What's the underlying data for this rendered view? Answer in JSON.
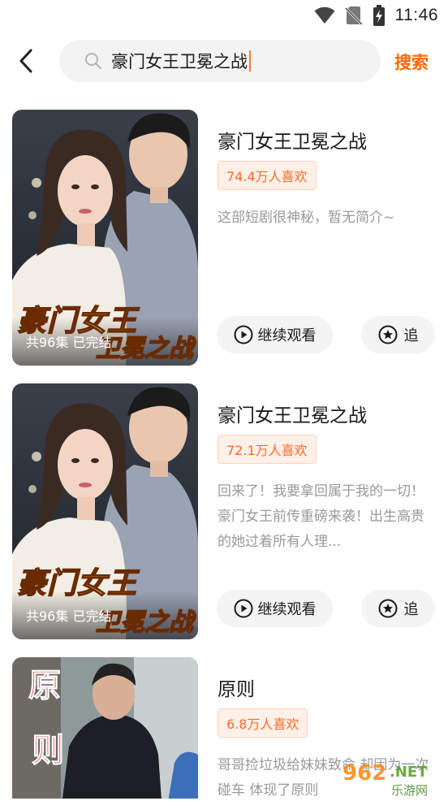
{
  "status": {
    "time": "11:46",
    "icons": [
      "wifi-icon",
      "no-sim-icon",
      "battery-icon"
    ]
  },
  "search": {
    "query": "豪门女王卫冕之战",
    "submit_label": "搜索"
  },
  "colors": {
    "accent": "#ff6a00",
    "badge_bg": "#fff0e8",
    "badge_text": "#ff6a2a",
    "desc_text": "#9a9a9a"
  },
  "results": [
    {
      "title": "豪门女王卫冕之战",
      "likes": "74.4万人喜欢",
      "description": "这部短剧很神秘，暂无简介~",
      "episodes": "共96集 已完结",
      "poster_art_line1": "豪门女王",
      "poster_art_line2": "卫冕之战",
      "watch_label": "继续观看",
      "follow_label": "追"
    },
    {
      "title": "豪门女王卫冕之战",
      "likes": "72.1万人喜欢",
      "description": "回来了！我要拿回属于我的一切！豪门女王前传重磅来袭！出生高贵的她过着所有人理...",
      "episodes": "共96集 已完结",
      "poster_art_line1": "豪门女王",
      "poster_art_line2": "卫冕之战",
      "watch_label": "继续观看",
      "follow_label": "追"
    },
    {
      "title": "原则",
      "likes": "6.8万人喜欢",
      "description": "哥哥捡垃圾给妹妹致命 却因为一次碰车 体现了原则",
      "poster_art_line1": "原",
      "poster_art_line2": "则"
    }
  ],
  "watermark": {
    "line1": "962",
    "line2": "NET",
    "line3": "乐游网"
  }
}
